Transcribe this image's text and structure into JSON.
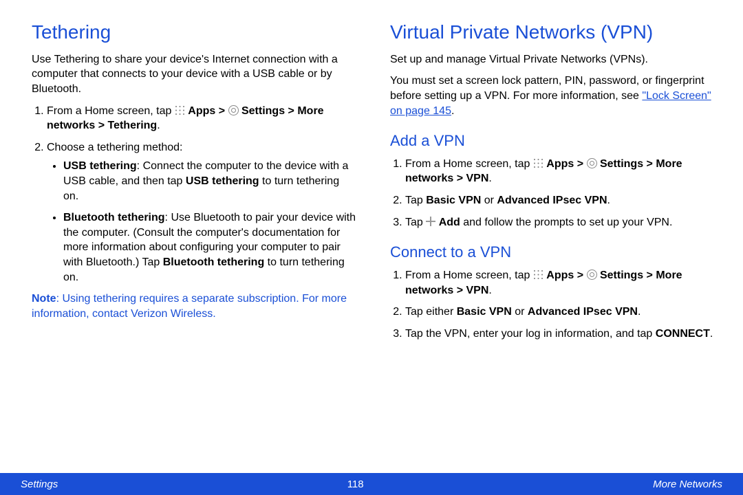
{
  "left": {
    "h1": "Tethering",
    "intro": "Use Tethering to share your device's Internet connection with a computer that connects to your device with a USB cable or by Bluetooth.",
    "step1_pre": "From a Home screen, tap ",
    "apps_label": "Apps > ",
    "settings_label": "Settings > More networks > Tethering",
    "step2_pre": "Choose a tethering method:",
    "usb_title": "USB tethering",
    "usb_body": ": Connect the computer to the device with a USB cable, and then tap ",
    "usb_bold2": "USB tethering",
    "usb_tail": " to turn tethering on.",
    "bt_title": "Bluetooth tethering",
    "bt_body": ": Use Bluetooth to pair your device with the computer. (Consult the computer's documentation for more information about configuring your computer to pair with Bluetooth.) Tap ",
    "bt_bold2": "Bluetooth tethering",
    "bt_tail": " to turn tethering on.",
    "note_label": "Note",
    "note_body": ": Using tethering requires a separate subscription. For more information, contact Verizon Wireless."
  },
  "right": {
    "h1": "Virtual Private Networks (VPN)",
    "p1": "Set up and manage Virtual Private Networks (VPNs).",
    "p2a": "You must set a screen lock pattern, PIN, password, or fingerprint before setting up a VPN. For more information, see ",
    "p2_link": "\"Lock Screen\" on page 145",
    "p2b": ".",
    "add": {
      "h2": "Add a VPN",
      "s1_pre": "From a Home screen, tap ",
      "apps_label": "Apps > ",
      "settings_label": "Settings > More networks > VPN",
      "s2_pre": "Tap ",
      "s2_bold": "Basic VPN",
      "s2_mid": " or ",
      "s2_bold2": "Advanced IPsec VPN",
      "s3_pre": "Tap ",
      "s3_add": "Add",
      "s3_tail": " and follow the prompts to set up your VPN."
    },
    "conn": {
      "h2": "Connect to a VPN",
      "s1_pre": "From a Home screen, tap ",
      "apps_label": "Apps > ",
      "settings_label": "Settings > More networks > VPN",
      "s2_pre": "Tap either ",
      "s2_bold": "Basic VPN",
      "s2_mid": " or ",
      "s2_bold2": "Advanced IPsec VPN",
      "s3_pre": "Tap the VPN, enter your log in information, and tap ",
      "s3_bold": "CONNECT"
    }
  },
  "footer": {
    "left": "Settings",
    "center": "118",
    "right": "More Networks"
  }
}
